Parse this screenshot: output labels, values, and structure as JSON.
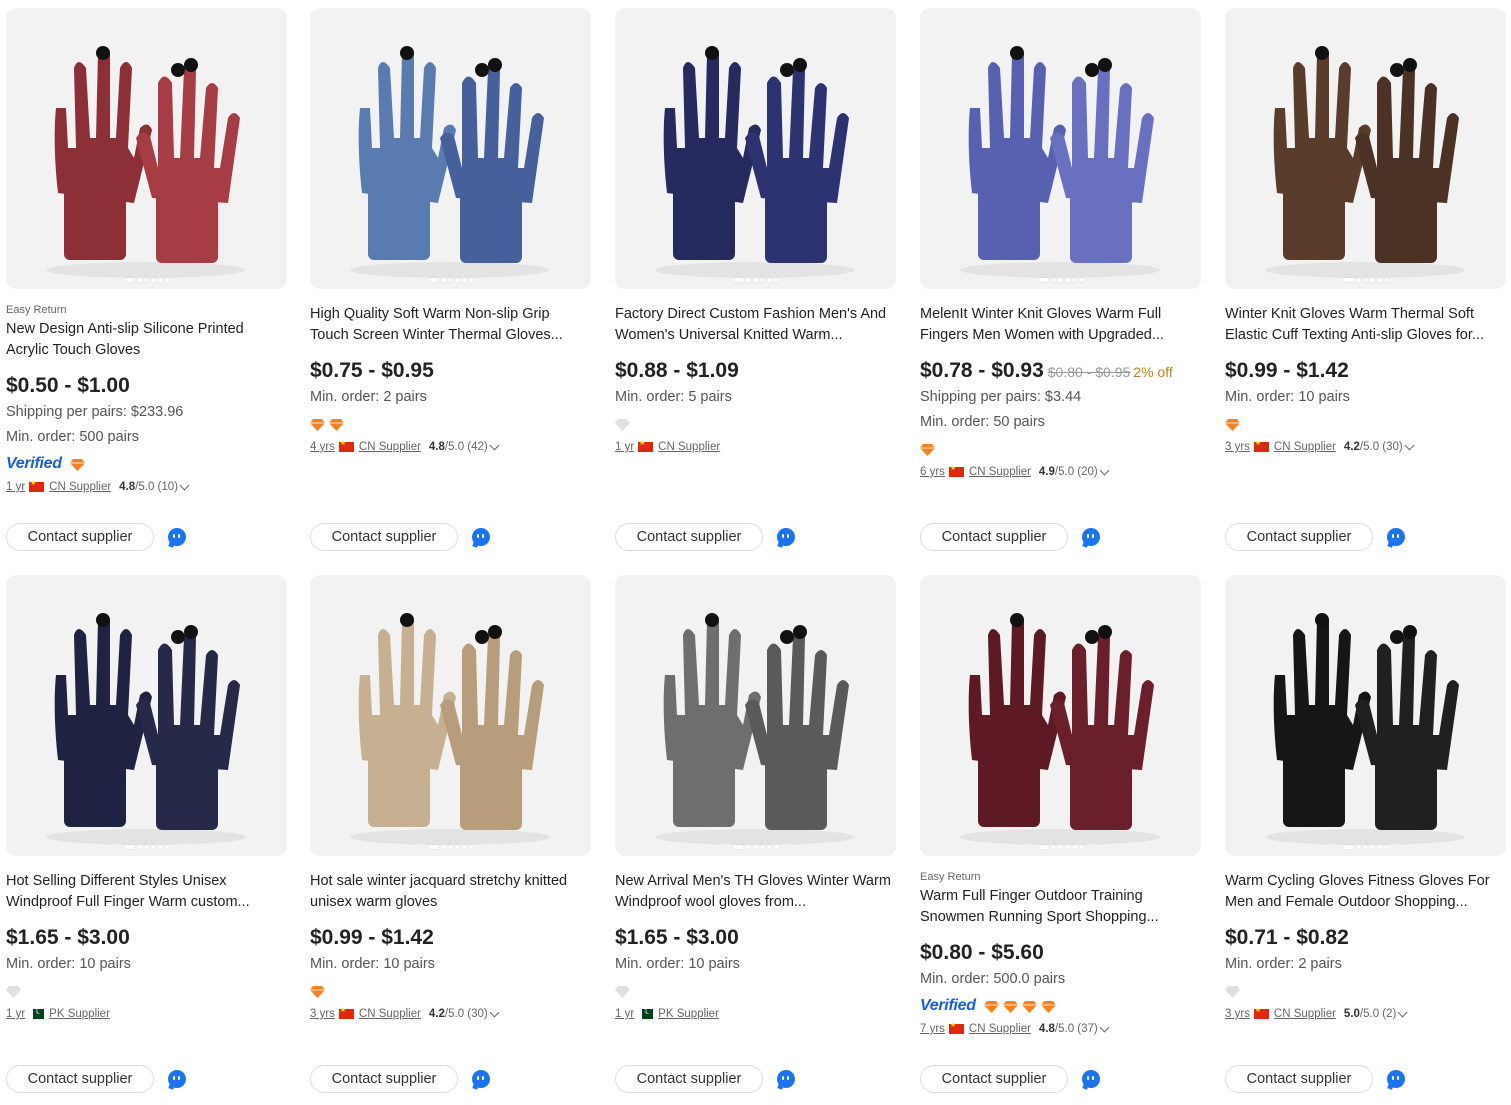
{
  "colors": {
    "accent": "#1c73f0",
    "verified": "#1a5fd6",
    "diamond": "#f5821f",
    "discount": "#c57f1a"
  },
  "products": [
    {
      "tag": "Easy Return",
      "title": "New Design Anti-slip Silicone Printed Acrylic Touch Gloves",
      "price": "$0.50 - $1.00",
      "orig_price": "",
      "discount": "",
      "shipping": "Shipping per pairs: $233.96",
      "min_order": "Min. order: 500 pairs",
      "verified": "Verified",
      "diamonds": 1,
      "years": "1 yr",
      "country": "cn",
      "supplier": "CN Supplier",
      "rating_score": "4.8",
      "rating_rest": "/5.0 (10)",
      "image_colors": [
        "#8c2f37",
        "#a63c44"
      ],
      "image_icon": "glove-image-red",
      "contact": "Contact supplier"
    },
    {
      "tag": "",
      "title": "High Quality Soft Warm Non-slip Grip Touch Screen Winter Thermal Gloves...",
      "price": "$0.75 - $0.95",
      "orig_price": "",
      "discount": "",
      "shipping": "",
      "min_order": "Min. order: 2 pairs",
      "verified": "",
      "diamonds": 2,
      "years": "4 yrs",
      "country": "cn",
      "supplier": "CN Supplier",
      "rating_score": "4.8",
      "rating_rest": "/5.0 (42)",
      "image_colors": [
        "#5a7bb0",
        "#45609a"
      ],
      "image_icon": "glove-image-blue",
      "contact": "Contact supplier"
    },
    {
      "tag": "",
      "title": "Factory Direct Custom Fashion Men's And Women's Universal Knitted Warm...",
      "price": "$0.88 - $1.09",
      "orig_price": "",
      "discount": "",
      "shipping": "",
      "min_order": "Min. order: 5 pairs",
      "verified": "",
      "diamonds": 0,
      "years": "1 yr",
      "country": "cn",
      "supplier": "CN Supplier",
      "rating_score": "",
      "rating_rest": "",
      "image_colors": [
        "#262a5e",
        "#2d3370"
      ],
      "image_icon": "glove-image-navy",
      "contact": "Contact supplier"
    },
    {
      "tag": "",
      "title": "MelenIt Winter Knit Gloves Warm Full Fingers Men Women with Upgraded...",
      "price": "$0.78 - $0.93",
      "orig_price": "$0.80 - $0.95",
      "discount": "2% off",
      "shipping": "Shipping per pairs: $3.44",
      "min_order": "Min. order: 50 pairs",
      "verified": "",
      "diamonds": 1,
      "years": "6 yrs",
      "country": "cn",
      "supplier": "CN Supplier",
      "rating_score": "4.9",
      "rating_rest": "/5.0 (20)",
      "image_colors": [
        "#5860b0",
        "#6a70c0"
      ],
      "image_icon": "glove-image-periwinkle",
      "contact": "Contact supplier"
    },
    {
      "tag": "",
      "title": "Winter Knit Gloves Warm Thermal Soft Elastic Cuff Texting Anti-slip Gloves for...",
      "price": "$0.99 - $1.42",
      "orig_price": "",
      "discount": "",
      "shipping": "",
      "min_order": "Min. order: 10 pairs",
      "verified": "",
      "diamonds": 1,
      "years": "3 yrs",
      "country": "cn",
      "supplier": "CN Supplier",
      "rating_score": "4.2",
      "rating_rest": "/5.0 (30)",
      "image_colors": [
        "#5a3c2c",
        "#4c3224"
      ],
      "image_icon": "glove-image-brown",
      "contact": "Contact supplier"
    },
    {
      "tag": "",
      "title": "Hot Selling Different Styles Unisex Windproof Full Finger Warm custom...",
      "price": "$1.65 - $3.00",
      "orig_price": "",
      "discount": "",
      "shipping": "",
      "min_order": "Min. order: 10 pairs",
      "verified": "",
      "diamonds": 0,
      "years": "1 yr",
      "country": "pk",
      "supplier": "PK Supplier",
      "rating_score": "",
      "rating_rest": "",
      "image_colors": [
        "#1f2240",
        "#262a48"
      ],
      "image_icon": "glove-image-darknavy",
      "contact": "Contact supplier"
    },
    {
      "tag": "",
      "title": "Hot sale winter jacquard stretchy knitted unisex warm gloves",
      "price": "$0.99 - $1.42",
      "orig_price": "",
      "discount": "",
      "shipping": "",
      "min_order": "Min. order: 10 pairs",
      "verified": "",
      "diamonds": 1,
      "years": "3 yrs",
      "country": "cn",
      "supplier": "CN Supplier",
      "rating_score": "4.2",
      "rating_rest": "/5.0 (30)",
      "image_colors": [
        "#c7b091",
        "#b89d7c"
      ],
      "image_icon": "glove-image-beige",
      "contact": "Contact supplier"
    },
    {
      "tag": "",
      "title": "New Arrival Men's TH Gloves Winter Warm Windproof wool gloves from...",
      "price": "$1.65 - $3.00",
      "orig_price": "",
      "discount": "",
      "shipping": "",
      "min_order": "Min. order: 10 pairs",
      "verified": "",
      "diamonds": 0,
      "years": "1 yr",
      "country": "pk",
      "supplier": "PK Supplier",
      "rating_score": "",
      "rating_rest": "",
      "image_colors": [
        "#6e6e6e",
        "#5a5a5a"
      ],
      "image_icon": "glove-image-gray",
      "contact": "Contact supplier"
    },
    {
      "tag": "Easy Return",
      "title": "Warm Full Finger Outdoor Training Snowmen Running Sport Shopping...",
      "price": "$0.80 - $5.60",
      "orig_price": "",
      "discount": "",
      "shipping": "",
      "min_order": "Min. order: 500.0 pairs",
      "verified": "Verified",
      "diamonds": 4,
      "years": "7 yrs",
      "country": "cn",
      "supplier": "CN Supplier",
      "rating_score": "4.8",
      "rating_rest": "/5.0 (37)",
      "image_colors": [
        "#5e1a24",
        "#6b1f2b"
      ],
      "image_icon": "glove-image-maroon",
      "contact": "Contact supplier"
    },
    {
      "tag": "",
      "title": "Warm Cycling Gloves Fitness Gloves For Men and Female Outdoor Shopping...",
      "price": "$0.71 - $0.82",
      "orig_price": "",
      "discount": "",
      "shipping": "",
      "min_order": "Min. order: 2 pairs",
      "verified": "",
      "diamonds": 0,
      "years": "3 yrs",
      "country": "cn",
      "supplier": "CN Supplier",
      "rating_score": "5.0",
      "rating_rest": "/5.0 (2)",
      "image_colors": [
        "#161616",
        "#202020"
      ],
      "image_icon": "glove-image-black",
      "contact": "Contact supplier"
    }
  ]
}
